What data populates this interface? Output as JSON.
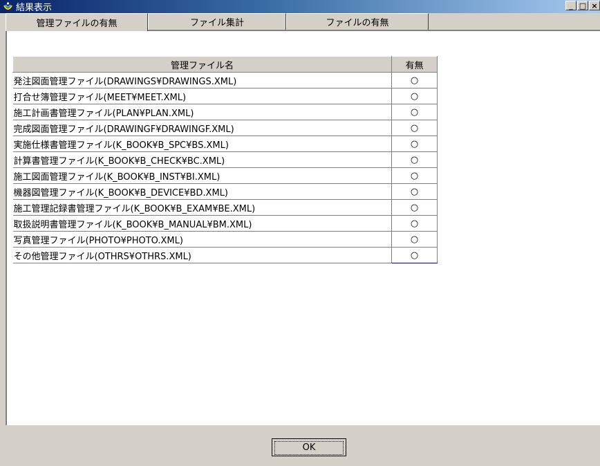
{
  "window": {
    "title": "結果表示",
    "minimize": "_",
    "maximize": "□",
    "close": "×"
  },
  "tabs": [
    {
      "label": "管理ファイルの有無",
      "active": true
    },
    {
      "label": "ファイル集計",
      "active": false
    },
    {
      "label": "ファイルの有無",
      "active": false
    }
  ],
  "table": {
    "headers": [
      "管理ファイル名",
      "有無"
    ],
    "rows": [
      {
        "name": "発注図面管理ファイル(DRAWINGS¥DRAWINGS.XML)",
        "present": "○"
      },
      {
        "name": "打合せ簿管理ファイル(MEET¥MEET.XML)",
        "present": "○"
      },
      {
        "name": "施工計画書管理ファイル(PLAN¥PLAN.XML)",
        "present": "○"
      },
      {
        "name": "完成図面管理ファイル(DRAWINGF¥DRAWINGF.XML)",
        "present": "○"
      },
      {
        "name": "実施仕様書管理ファイル(K_BOOK¥B_SPC¥BS.XML)",
        "present": "○"
      },
      {
        "name": "計算書管理ファイル(K_BOOK¥B_CHECK¥BC.XML)",
        "present": "○"
      },
      {
        "name": "施工図面管理ファイル(K_BOOK¥B_INST¥BI.XML)",
        "present": "○"
      },
      {
        "name": "機器図管理ファイル(K_BOOK¥B_DEVICE¥BD.XML)",
        "present": "○"
      },
      {
        "name": "施工管理記録書管理ファイル(K_BOOK¥B_EXAM¥BE.XML)",
        "present": "○"
      },
      {
        "name": "取扱説明書管理ファイル(K_BOOK¥B_MANUAL¥BM.XML)",
        "present": "○"
      },
      {
        "name": "写真管理ファイル(PHOTO¥PHOTO.XML)",
        "present": "○"
      },
      {
        "name": "その他管理ファイル(OTHRS¥OTHRS.XML)",
        "present": "○"
      }
    ]
  },
  "buttons": {
    "ok": "OK"
  },
  "colors": {
    "titlebar_start": "#0a246a",
    "titlebar_end": "#a6caf0",
    "face": "#d4d0c8"
  }
}
